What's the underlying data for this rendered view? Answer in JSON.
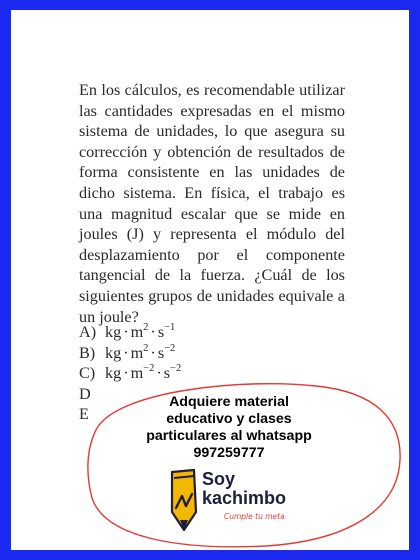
{
  "question": {
    "paragraph": "En los cálculos, es recomendable utilizar las cantidades expresadas en el mismo sistema de unidades, lo que asegura su corrección y obtención de resultados de forma consistente en las unidades de dicho sistema. En física, el trabajo es una magnitud escalar que se mide en joules (J) y representa el módulo del desplazamiento por el componente tangencial de la fuerza. ¿Cuál de los siguientes grupos de unidades equivale a un joule?",
    "options": [
      {
        "letter": "A)",
        "base1": "kg",
        "base2": "m",
        "exp2": "2",
        "base3": "s",
        "exp3": "−1"
      },
      {
        "letter": "B)",
        "base1": "kg",
        "base2": "m",
        "exp2": "2",
        "base3": "s",
        "exp3": "−2"
      },
      {
        "letter": "C)",
        "base1": "kg",
        "base2": "m",
        "exp2": "−2",
        "base3": "s",
        "exp3": "−2"
      },
      {
        "letter": "D",
        "base1": "",
        "base2": "",
        "exp2": "",
        "base3": "",
        "exp3": ""
      },
      {
        "letter": "E",
        "base1": "",
        "base2": "",
        "exp2": "",
        "base3": "",
        "exp3": ""
      }
    ]
  },
  "ad": {
    "line1": "Adquiere material",
    "line2": "educativo y clases",
    "line3": "particulares al whatsapp",
    "line4": "997259777",
    "logo_title_1": "Soy",
    "logo_title_2": "kachimbo",
    "logo_tagline": "Cumple tu meta",
    "border_color": "#e53935"
  },
  "colors": {
    "frame": "#1a2af0",
    "text": "#2a2a2a",
    "logo_pencil": "#f5b800",
    "logo_dark": "#1f1f3a"
  }
}
